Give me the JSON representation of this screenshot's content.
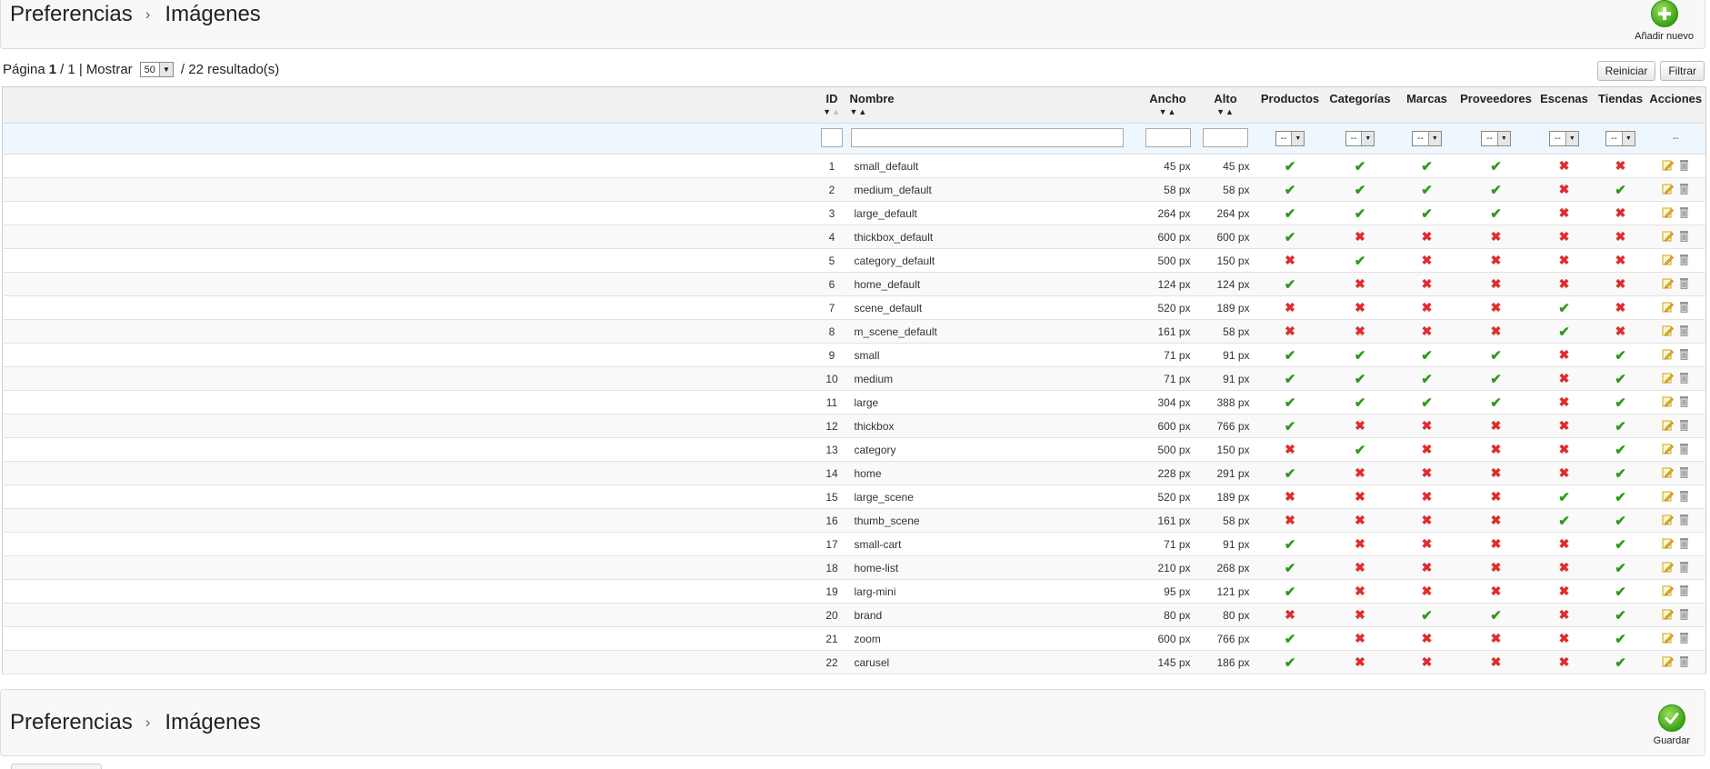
{
  "toolbar": {
    "crumb1": "Preferencias",
    "crumb2": "Imágenes",
    "add_label": "Añadir nuevo",
    "save_label": "Guardar"
  },
  "pager": {
    "page_prefix": "Página",
    "page_current": "1",
    "page_total_text": "/ 1 |",
    "show_label": "Mostrar",
    "per_page": "50",
    "results_text": "/ 22 resultado(s)"
  },
  "buttons": {
    "reset": "Reiniciar",
    "filter": "Filtrar"
  },
  "columns": {
    "id": "ID",
    "name": "Nombre",
    "width": "Ancho",
    "height": "Alto",
    "products": "Productos",
    "categories": "Categorías",
    "brands": "Marcas",
    "suppliers": "Proveedores",
    "scenes": "Escenas",
    "stores": "Tiendas",
    "actions": "Acciones"
  },
  "filter": {
    "select_value": "--",
    "actions_placeholder": "--"
  },
  "colors": {
    "check": "#2e9a1a",
    "cross": "#e02c2c",
    "filter_row": "#eef7fd"
  },
  "rows": [
    {
      "id": "1",
      "name": "small_default",
      "w": "45 px",
      "h": "45 px",
      "f": [
        1,
        1,
        1,
        1,
        0,
        0
      ]
    },
    {
      "id": "2",
      "name": "medium_default",
      "w": "58 px",
      "h": "58 px",
      "f": [
        1,
        1,
        1,
        1,
        0,
        1
      ]
    },
    {
      "id": "3",
      "name": "large_default",
      "w": "264 px",
      "h": "264 px",
      "f": [
        1,
        1,
        1,
        1,
        0,
        0
      ]
    },
    {
      "id": "4",
      "name": "thickbox_default",
      "w": "600 px",
      "h": "600 px",
      "f": [
        1,
        0,
        0,
        0,
        0,
        0
      ]
    },
    {
      "id": "5",
      "name": "category_default",
      "w": "500 px",
      "h": "150 px",
      "f": [
        0,
        1,
        0,
        0,
        0,
        0
      ]
    },
    {
      "id": "6",
      "name": "home_default",
      "w": "124 px",
      "h": "124 px",
      "f": [
        1,
        0,
        0,
        0,
        0,
        0
      ]
    },
    {
      "id": "7",
      "name": "scene_default",
      "w": "520 px",
      "h": "189 px",
      "f": [
        0,
        0,
        0,
        0,
        1,
        0
      ]
    },
    {
      "id": "8",
      "name": "m_scene_default",
      "w": "161 px",
      "h": "58 px",
      "f": [
        0,
        0,
        0,
        0,
        1,
        0
      ]
    },
    {
      "id": "9",
      "name": "small",
      "w": "71 px",
      "h": "91 px",
      "f": [
        1,
        1,
        1,
        1,
        0,
        1
      ]
    },
    {
      "id": "10",
      "name": "medium",
      "w": "71 px",
      "h": "91 px",
      "f": [
        1,
        1,
        1,
        1,
        0,
        1
      ]
    },
    {
      "id": "11",
      "name": "large",
      "w": "304 px",
      "h": "388 px",
      "f": [
        1,
        1,
        1,
        1,
        0,
        1
      ]
    },
    {
      "id": "12",
      "name": "thickbox",
      "w": "600 px",
      "h": "766 px",
      "f": [
        1,
        0,
        0,
        0,
        0,
        1
      ]
    },
    {
      "id": "13",
      "name": "category",
      "w": "500 px",
      "h": "150 px",
      "f": [
        0,
        1,
        0,
        0,
        0,
        1
      ]
    },
    {
      "id": "14",
      "name": "home",
      "w": "228 px",
      "h": "291 px",
      "f": [
        1,
        0,
        0,
        0,
        0,
        1
      ]
    },
    {
      "id": "15",
      "name": "large_scene",
      "w": "520 px",
      "h": "189 px",
      "f": [
        0,
        0,
        0,
        0,
        1,
        1
      ]
    },
    {
      "id": "16",
      "name": "thumb_scene",
      "w": "161 px",
      "h": "58 px",
      "f": [
        0,
        0,
        0,
        0,
        1,
        1
      ]
    },
    {
      "id": "17",
      "name": "small-cart",
      "w": "71 px",
      "h": "91 px",
      "f": [
        1,
        0,
        0,
        0,
        0,
        1
      ]
    },
    {
      "id": "18",
      "name": "home-list",
      "w": "210 px",
      "h": "268 px",
      "f": [
        1,
        0,
        0,
        0,
        0,
        1
      ]
    },
    {
      "id": "19",
      "name": "larg-mini",
      "w": "95 px",
      "h": "121 px",
      "f": [
        1,
        0,
        0,
        0,
        0,
        1
      ]
    },
    {
      "id": "20",
      "name": "brand",
      "w": "80 px",
      "h": "80 px",
      "f": [
        0,
        0,
        1,
        1,
        0,
        1
      ]
    },
    {
      "id": "21",
      "name": "zoom",
      "w": "600 px",
      "h": "766 px",
      "f": [
        1,
        0,
        0,
        0,
        0,
        1
      ]
    },
    {
      "id": "22",
      "name": "carusel",
      "w": "145 px",
      "h": "186 px",
      "f": [
        1,
        0,
        0,
        0,
        0,
        1
      ]
    }
  ]
}
